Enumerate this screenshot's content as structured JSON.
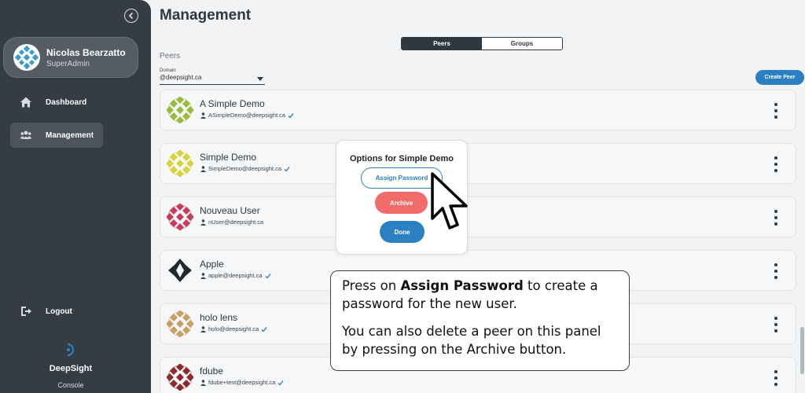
{
  "sidebar": {
    "profile": {
      "name": "Nicolas Bearzatto",
      "role": "SuperAdmin"
    },
    "nav": [
      {
        "label": "Dashboard",
        "icon": "home-icon"
      },
      {
        "label": "Management",
        "icon": "users-icon"
      }
    ],
    "logout": {
      "label": "Logout",
      "icon": "logout-icon"
    },
    "brand": {
      "name": "DeepSight",
      "sub": "Console"
    }
  },
  "main": {
    "title": "Management",
    "tabs": [
      {
        "label": "Peers",
        "active": true
      },
      {
        "label": "Groups",
        "active": false
      }
    ],
    "section_label": "Peers",
    "domain": {
      "label": "Domain",
      "value": "@deepsight.ca"
    },
    "create_button": "Create Peer",
    "peers": [
      {
        "name": "A Simple Demo",
        "email": "ASimpleDemo@deepsight.ca",
        "verified": true,
        "color": "#9bbb3a"
      },
      {
        "name": "Simple Demo",
        "email": "SimpleDemo@deepsight.ca",
        "verified": true,
        "color": "#d9d23a"
      },
      {
        "name": "Nouveau User",
        "email": "nUser@deepsight.ca",
        "verified": false,
        "color": "#c73b5a"
      },
      {
        "name": "Apple",
        "email": "apple@deepsight.ca",
        "verified": true,
        "color": "#1f2a2a"
      },
      {
        "name": "holo lens",
        "email": "holo@deepsight.ca",
        "verified": true,
        "color": "#c9a062"
      },
      {
        "name": "fdube",
        "email": "fdube+test@deepsight.ca",
        "verified": true,
        "color": "#8c2a2a"
      }
    ]
  },
  "modal": {
    "title": "Options for Simple Demo",
    "assign_label": "Assign Password",
    "archive_label": "Archive",
    "done_label": "Done"
  },
  "callout": {
    "p1_prefix": "Press on ",
    "p1_bold": "Assign Password",
    "p1_suffix": " to create a password for the new user.",
    "p2": "You can also delete a peer on this panel by pressing on the Archive button."
  },
  "colors": {
    "sidebar": "#353c44",
    "accent": "#2a80c2",
    "danger": "#f26b6b"
  }
}
